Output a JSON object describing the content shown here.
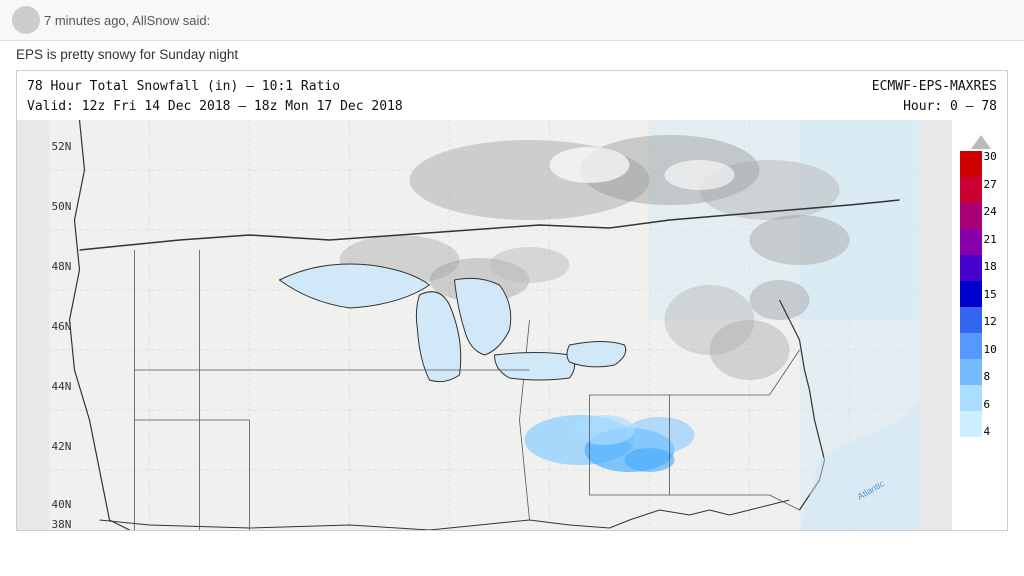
{
  "topbar": {
    "time_ago": "7 minutes ago, AllSnow said:",
    "avatar": ""
  },
  "post": {
    "body": "EPS is pretty snowy for Sunday night"
  },
  "weather": {
    "title_line1": "78 Hour Total Snowfall (in) – 10:1 Ratio",
    "title_line2": "Valid: 12z Fri 14 Dec 2018 – 18z Mon 17 Dec 2018",
    "model_line1": "ECMWF-EPS-MAXRES",
    "model_line2": "Hour: 0 – 78"
  },
  "legend": {
    "values": [
      30,
      27,
      24,
      21,
      18,
      15,
      12,
      10,
      8,
      6,
      4
    ],
    "colors": [
      "#cc0000",
      "#dd0044",
      "#bb0077",
      "#8800aa",
      "#5500cc",
      "#0000cc",
      "#0044ee",
      "#0088ff",
      "#44aaff",
      "#88ccff",
      "#aaddff"
    ]
  }
}
